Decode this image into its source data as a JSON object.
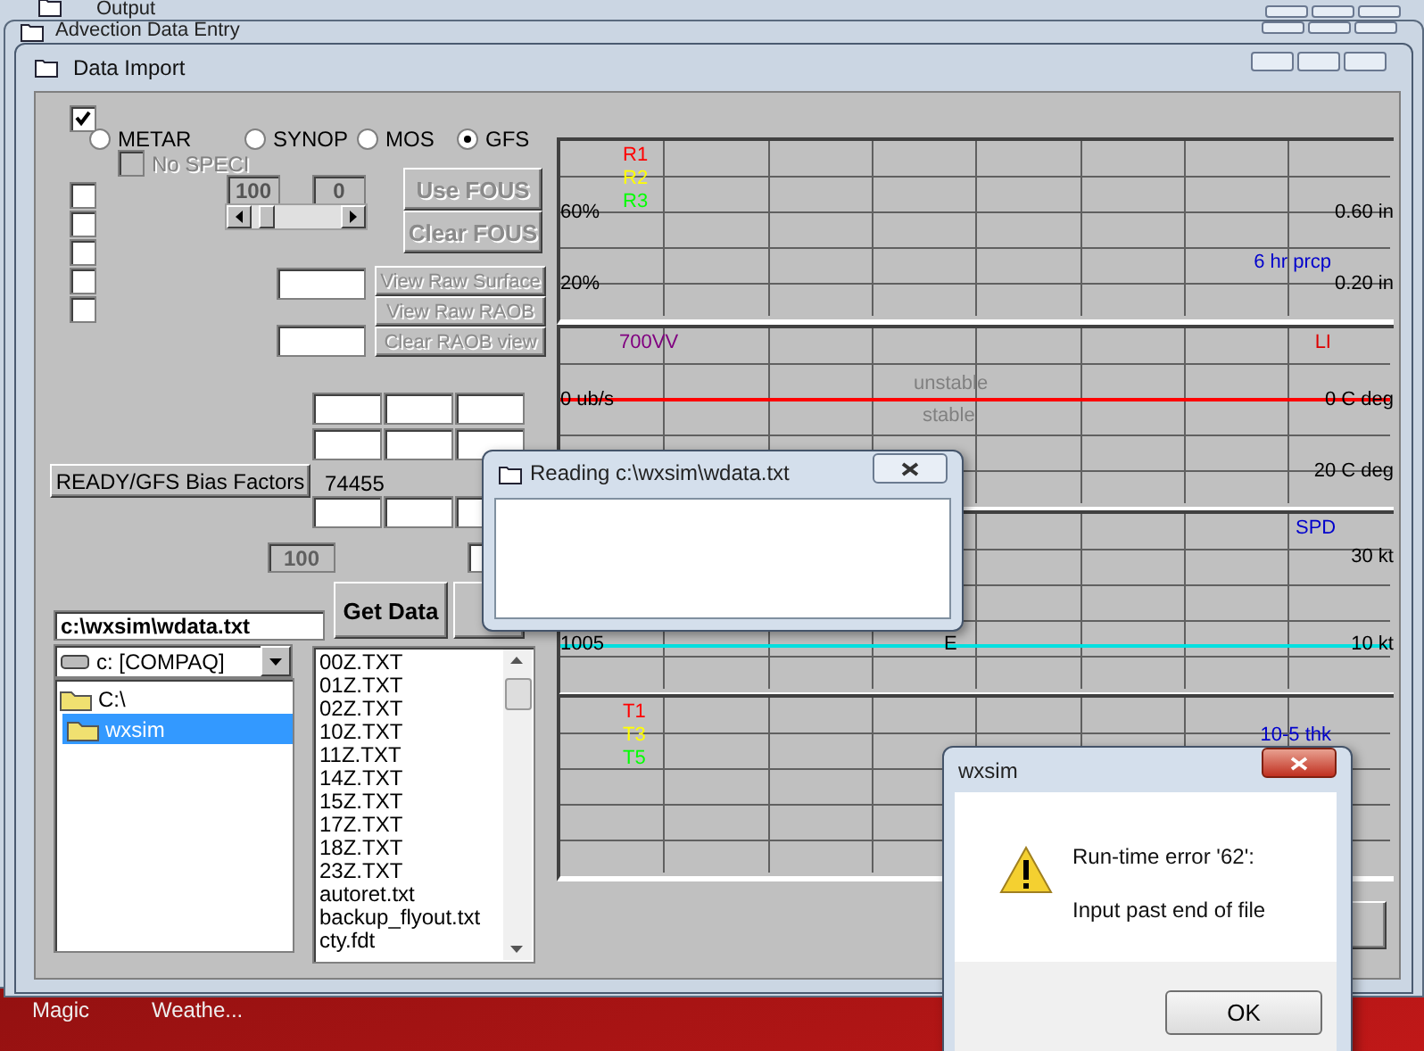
{
  "background_windows": [
    {
      "title": "Output"
    },
    {
      "title": "Advection Data Entry"
    }
  ],
  "desktop_icons": [
    {
      "label": "Magic"
    },
    {
      "label": "Weathe..."
    }
  ],
  "window": {
    "title": "Data Import",
    "top_checkbox": {
      "checked": true
    },
    "sources": [
      {
        "label": "METAR",
        "selected": false
      },
      {
        "label": "SYNOP",
        "selected": false
      },
      {
        "label": "MOS",
        "selected": false
      },
      {
        "label": "GFS",
        "selected": true
      }
    ],
    "no_speci": {
      "label": "No SPECI",
      "checked": false,
      "disabled": true
    },
    "checkboxes": [
      {
        "checked": false
      },
      {
        "checked": false
      },
      {
        "checked": false
      },
      {
        "checked": false
      },
      {
        "checked": false
      }
    ],
    "range_fields": [
      "100",
      "0"
    ],
    "fous_buttons": [
      {
        "label": "Use FOUS",
        "disabled": true
      },
      {
        "label": "Clear FOUS",
        "disabled": true
      }
    ],
    "raw_buttons": [
      {
        "label": "View Raw Surface",
        "disabled": true
      },
      {
        "label": "View Raw RAOB",
        "disabled": true
      },
      {
        "label": "Clear RAOB view",
        "disabled": true
      }
    ],
    "bias_button": {
      "label": "READY/GFS Bias Factors"
    },
    "station": "74455",
    "percent_field": {
      "value": "100",
      "disabled": true
    },
    "get_data_button": {
      "label": "Get Data"
    },
    "path_field": {
      "value": "c:\\wxsim\\wdata.txt"
    },
    "drive_combo": {
      "value": "c: [COMPAQ]"
    },
    "folders": [
      {
        "label": "C:\\",
        "selected": false
      },
      {
        "label": "wxsim",
        "selected": true
      }
    ],
    "files": [
      {
        "label": "00Z.TXT",
        "selected": false
      },
      {
        "label": "01Z.TXT",
        "selected": false
      },
      {
        "label": "02Z.TXT",
        "selected": false
      },
      {
        "label": "10Z.TXT",
        "selected": false
      },
      {
        "label": "11Z.TXT",
        "selected": false
      },
      {
        "label": "14Z.TXT",
        "selected": false
      },
      {
        "label": "15Z.TXT",
        "selected": false
      },
      {
        "label": "17Z.TXT",
        "selected": false
      },
      {
        "label": "18Z.TXT",
        "selected": false
      },
      {
        "label": "23Z.TXT",
        "selected": false
      },
      {
        "label": "autoret.txt",
        "selected": false
      },
      {
        "label": "backup_flyout.txt",
        "selected": false
      },
      {
        "label": "cty.fdt",
        "selected": false
      }
    ],
    "chart_panels": [
      {
        "labels": [
          {
            "text": "R1",
            "color": "#ff0000"
          },
          {
            "text": "R2",
            "color": "#ffff00"
          },
          {
            "text": "R3",
            "color": "#00ff00"
          },
          {
            "text": "60%",
            "color": "#000000"
          },
          {
            "text": "0.60 in",
            "color": "#000000"
          },
          {
            "text": "6 hr prcp",
            "color": "#0000cc"
          },
          {
            "text": "20%",
            "color": "#000000"
          },
          {
            "text": "0.20 in",
            "color": "#000000"
          }
        ]
      },
      {
        "labels": [
          {
            "text": "700VV",
            "color": "#800080"
          },
          {
            "text": "LI",
            "color": "#dd0000"
          },
          {
            "text": "0 ub/s",
            "color": "#000000"
          },
          {
            "text": "0 C deg",
            "color": "#000000"
          },
          {
            "text": "unstable",
            "color": "#808080"
          },
          {
            "text": "stable",
            "color": "#808080"
          },
          {
            "text": "20 C deg",
            "color": "#000000"
          }
        ],
        "lines": [
          {
            "color": "#ff0000"
          }
        ]
      },
      {
        "labels": [
          {
            "text": "SPD",
            "color": "#0000cc"
          },
          {
            "text": "30 kt",
            "color": "#000000"
          },
          {
            "text": "1005",
            "color": "#000000"
          },
          {
            "text": "E",
            "color": "#000000"
          },
          {
            "text": "10 kt",
            "color": "#000000"
          }
        ],
        "lines": [
          {
            "color": "#00e0e0"
          }
        ]
      },
      {
        "labels": [
          {
            "text": "T1",
            "color": "#ff0000"
          },
          {
            "text": "T3",
            "color": "#ffff00"
          },
          {
            "text": "T5",
            "color": "#00ff00"
          },
          {
            "text": "10-5 thk",
            "color": "#0000cc"
          }
        ]
      }
    ]
  },
  "progress_dialog": {
    "title": "Reading c:\\wxsim\\wdata.txt"
  },
  "error_dialog": {
    "title": "wxsim",
    "heading": "Run-time error '62':",
    "message": "Input past end of file",
    "ok_button": "OK"
  }
}
